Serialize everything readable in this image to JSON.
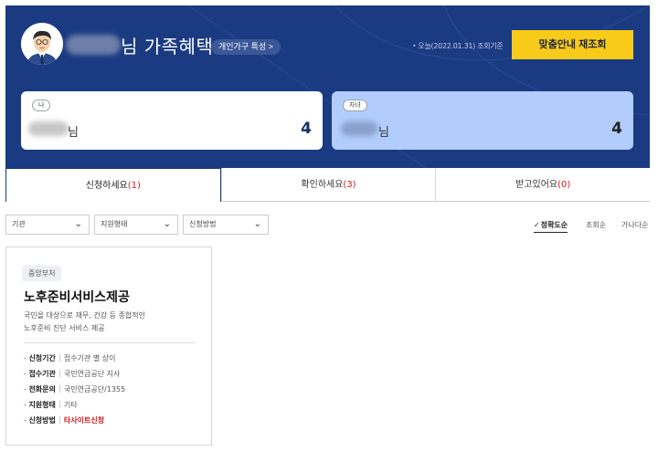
{
  "header": {
    "title": "님 가족혜택",
    "trait_button": "개인가구 특성 >",
    "date_note": "오늘(2022.01.31) 조회기준",
    "reload_button": "맞춤안내 재조회"
  },
  "family": [
    {
      "tag": "나",
      "suffix": "님",
      "count": "4"
    },
    {
      "tag": "자녀",
      "suffix": "님",
      "count": "4"
    }
  ],
  "tabs": [
    {
      "label": "신청하세요",
      "count": "(1)",
      "active": true
    },
    {
      "label": "확인하세요",
      "count": "(3)",
      "active": false
    },
    {
      "label": "받고있어요",
      "count": "(0)",
      "active": false
    }
  ],
  "filters": [
    {
      "label": "기관"
    },
    {
      "label": "지원형태"
    },
    {
      "label": "신청방법"
    }
  ],
  "sort": [
    {
      "label": "정확도순",
      "active": true
    },
    {
      "label": "조회순",
      "active": false
    },
    {
      "label": "가나다순",
      "active": false
    }
  ],
  "benefit": {
    "badge": "중앙부처",
    "name": "노후준비서비스제공",
    "desc_line1": "국민을 대상으로 재무, 건강 등 종합적인",
    "desc_line2": "노후준비 진단 서비스 제공",
    "rows": [
      {
        "label": "신청기간",
        "value": "접수기관 별 상이"
      },
      {
        "label": "접수기관",
        "value": "국민연금공단 지사"
      },
      {
        "label": "전화문의",
        "value": "국민연금공단/1355"
      },
      {
        "label": "지원형태",
        "value": "기타"
      },
      {
        "label": "신청방법",
        "value": "타사이트신청"
      }
    ]
  },
  "colors": {
    "banner": "#1a3a82",
    "accent_yellow": "#f8cb1a",
    "child_card": "#b2cdfc",
    "count_red": "#d01b1b"
  }
}
